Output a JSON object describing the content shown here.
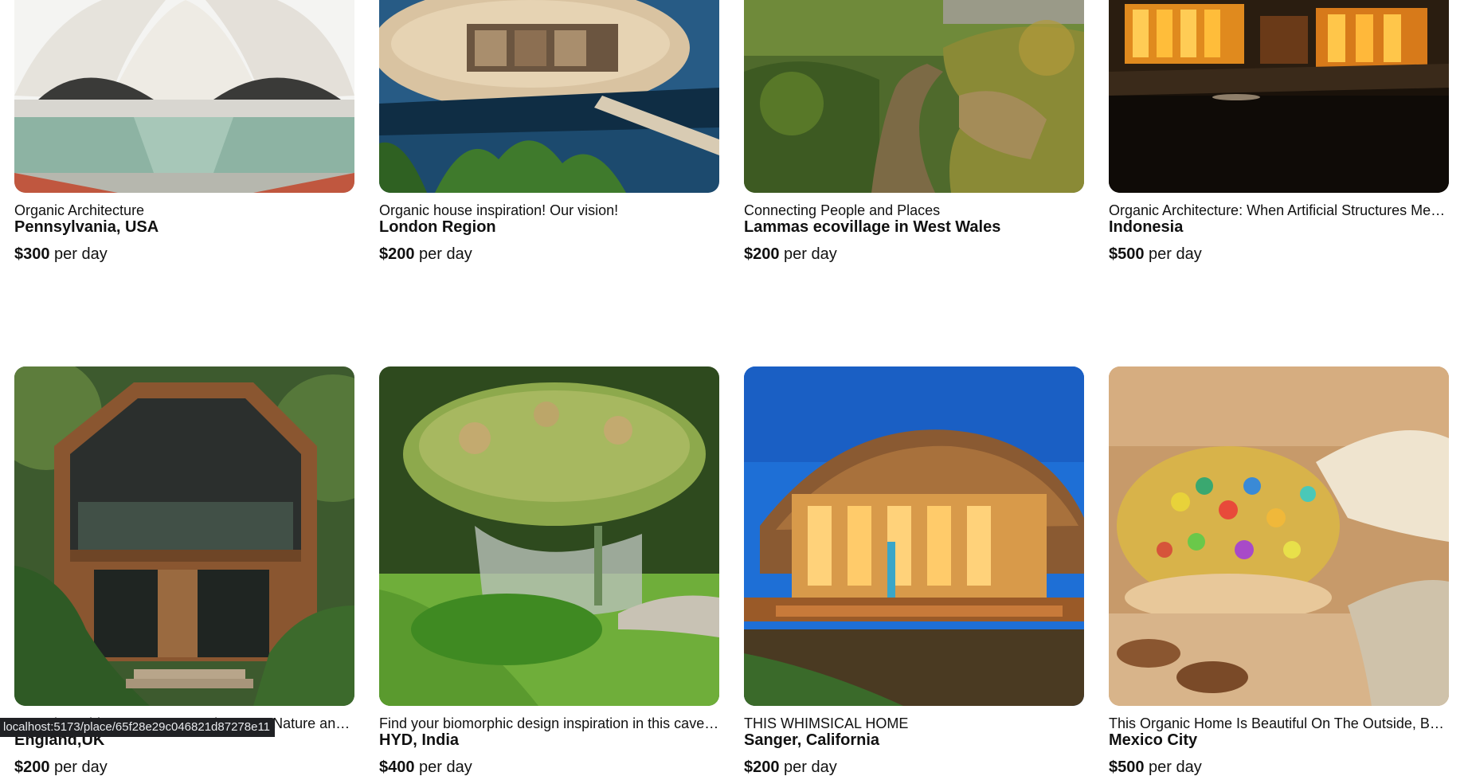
{
  "listings": [
    {
      "subtitle": "Organic Architecture",
      "location": "Pennsylvania, USA",
      "price": "$300",
      "unit": " per day",
      "image": "lotus-temple-photo"
    },
    {
      "subtitle": "Organic house inspiration! Our vision!",
      "location": "London Region",
      "price": "$200",
      "unit": " per day",
      "image": "floating-pod-house-photo"
    },
    {
      "subtitle": "Connecting People and Places",
      "location": "Lammas ecovillage in West Wales",
      "price": "$200",
      "unit": " per day",
      "image": "ecovillage-path-photo"
    },
    {
      "subtitle": "Organic Architecture: When Artificial Structures Meet Nature",
      "location": "Indonesia",
      "price": "$500",
      "unit": " per day",
      "image": "night-wooden-house-photo"
    },
    {
      "subtitle": "Organic Architecture: Harmony between Nature and Structure",
      "location": "England,UK",
      "price": "$200",
      "unit": " per day",
      "image": "jungle-cabin-photo"
    },
    {
      "subtitle": "Find your biomorphic design inspiration in this cave-like home",
      "location": "HYD, India",
      "price": "$400",
      "unit": " per day",
      "image": "green-roof-dome-photo"
    },
    {
      "subtitle": "THIS WHIMSICAL HOME",
      "location": "Sanger, California",
      "price": "$200",
      "unit": " per day",
      "image": "curved-wood-home-photo"
    },
    {
      "subtitle": "This Organic Home Is Beautiful On The Outside, But Inside Is Magical",
      "location": "Mexico City",
      "price": "$500",
      "unit": " per day",
      "image": "stained-glass-interior-photo"
    }
  ],
  "status_bar": {
    "url": "localhost:5173/place/65f28e29c046821d87278e11"
  }
}
